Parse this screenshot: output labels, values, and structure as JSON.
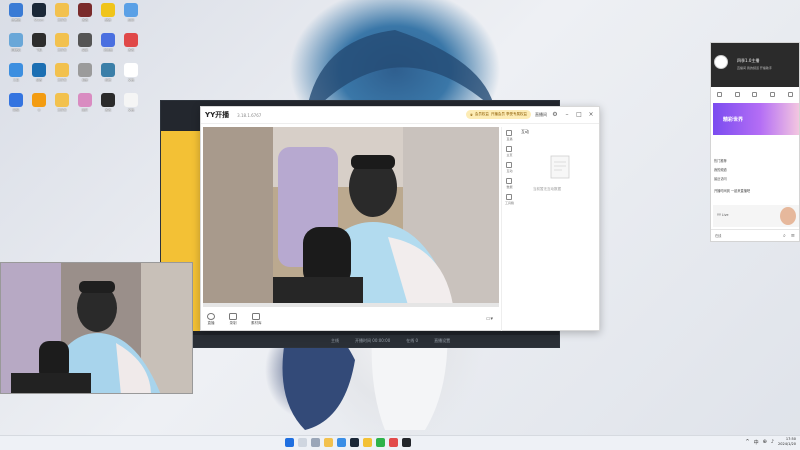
{
  "main_window": {
    "brand": "YY开播",
    "version": "3.18.1.6767",
    "vip_label": "会员权益",
    "vip_desc": "开播会员 享受专属权益",
    "upgrade_label": "直播间",
    "tools": [
      "直播",
      "录制",
      "素材库"
    ],
    "side_nav": [
      "直播",
      "主页",
      "互动",
      "数据",
      "工具箱"
    ],
    "panel_tab": "互动",
    "empty_text": "当前暂无互动数据"
  },
  "back_window": {
    "status_items": [
      "主线",
      "开播时间 00:00:00",
      "在线 0",
      "直播设置"
    ]
  },
  "chat_panel": {
    "name": "四季1.0主播",
    "subtitle": "直播间 我的频道 开播助手",
    "banner_text": "精彩世界",
    "list_items": [
      "热门推荐",
      "我的频道",
      "最近访问"
    ],
    "card_title": "开播时间到 一起来直播吧",
    "card_sub": "YY Live",
    "bottom_label": "在线"
  },
  "desktop_icons": [
    {
      "label": "此电脑",
      "color": "#3a7bd5"
    },
    {
      "label": "Steam",
      "color": "#1b2838"
    },
    {
      "label": "文件夹",
      "color": "#f2c14e"
    },
    {
      "label": "游戏",
      "color": "#7a2b2b"
    },
    {
      "label": "酷狗",
      "color": "#f0c419"
    },
    {
      "label": "应用",
      "color": "#5aa0e6"
    },
    {
      "label": "回收站",
      "color": "#6aa7d8"
    },
    {
      "label": "飞机",
      "color": "#2d2d2d"
    },
    {
      "label": "文件夹",
      "color": "#f2c14e"
    },
    {
      "label": "画笔",
      "color": "#555555"
    },
    {
      "label": "浏览器",
      "color": "#4a6fe0"
    },
    {
      "label": "游戏",
      "color": "#e04848"
    },
    {
      "label": "工具",
      "color": "#3d8fe0"
    },
    {
      "label": "设置",
      "color": "#1c6fb3"
    },
    {
      "label": "文件夹",
      "color": "#f2c14e"
    },
    {
      "label": "相册",
      "color": "#9b9b9b"
    },
    {
      "label": "终端",
      "color": "#3b7fa8"
    },
    {
      "label": "文档",
      "color": "#ffffff"
    },
    {
      "label": "网络",
      "color": "#3474e0"
    },
    {
      "label": "Q",
      "color": "#f39c12"
    },
    {
      "label": "文件夹",
      "color": "#f2c14e"
    },
    {
      "label": "图片",
      "color": "#d98cc1"
    },
    {
      "label": "游戏",
      "color": "#2b2b2b"
    },
    {
      "label": "文档",
      "color": "#f5f5f5"
    }
  ],
  "taskbar": {
    "time": "17:50",
    "date": "2024/1/20",
    "tray": [
      "^",
      "中",
      "⊕",
      "♪"
    ]
  }
}
